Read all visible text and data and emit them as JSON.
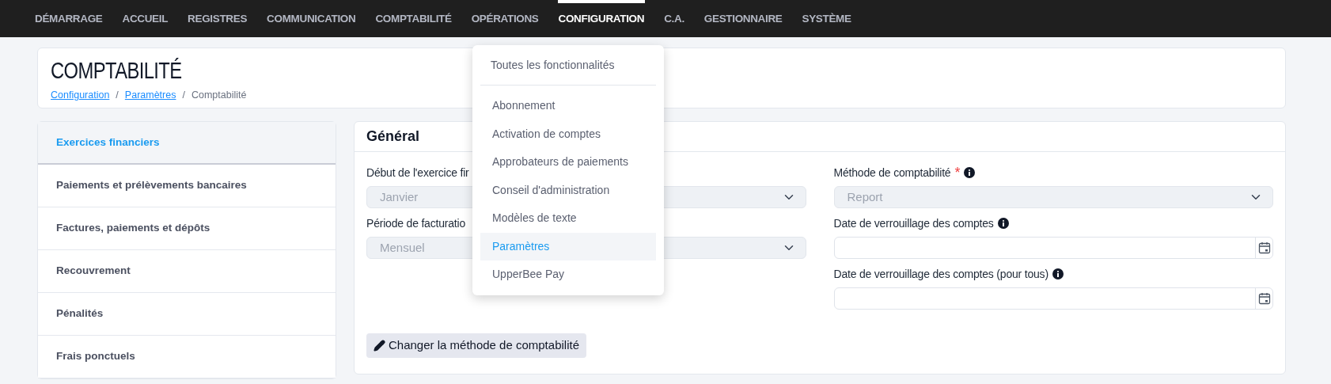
{
  "nav": [
    {
      "label": "DÉMARRAGE",
      "selected": false
    },
    {
      "label": "ACCUEIL",
      "selected": false
    },
    {
      "label": "REGISTRES",
      "selected": false
    },
    {
      "label": "COMMUNICATION",
      "selected": false
    },
    {
      "label": "COMPTABILITÉ",
      "selected": false
    },
    {
      "label": "OPÉRATIONS",
      "selected": false
    },
    {
      "label": "CONFIGURATION",
      "selected": true
    },
    {
      "label": "C.A.",
      "selected": false
    },
    {
      "label": "GESTIONNAIRE",
      "selected": false
    },
    {
      "label": "SYSTÈME",
      "selected": false
    }
  ],
  "page": {
    "title": "COMPTABILITÉ",
    "breadcrumb": [
      {
        "kind": "link",
        "label": "Configuration"
      },
      {
        "kind": "separator",
        "label": "/"
      },
      {
        "kind": "link",
        "label": "Paramètres"
      },
      {
        "kind": "separator",
        "label": "/"
      },
      {
        "kind": "current",
        "label": "Comptabilité"
      }
    ]
  },
  "sidebar": [
    {
      "label": "Exercices financiers",
      "selected": true
    },
    {
      "label": "Paiements et prélèvements bancaires",
      "selected": false
    },
    {
      "label": "Factures, paiements et dépôts",
      "selected": false
    },
    {
      "label": "Recouvrement",
      "selected": false
    },
    {
      "label": "Pénalités",
      "selected": false
    },
    {
      "label": "Frais ponctuels",
      "selected": false
    }
  ],
  "section": {
    "title": "Général",
    "left_fields": [
      {
        "kind": "select",
        "label": "Début de l'exercice fir",
        "value": "Janvier"
      },
      {
        "kind": "select",
        "label": "Période de facturatio",
        "value": "Mensuel"
      }
    ],
    "right_fields": [
      {
        "kind": "select",
        "label": "Méthode de comptabilité",
        "value": "Report",
        "required": true,
        "info": true
      },
      {
        "kind": "date",
        "label": "Date de verrouillage des comptes",
        "required": false,
        "info": true
      },
      {
        "kind": "date",
        "label": "Date de verrouillage des comptes (pour tous)",
        "required": false,
        "info": true
      }
    ],
    "required_mark": "*",
    "button": "Changer la méthode de comptabilité"
  },
  "menu": {
    "top_item": {
      "label": "Toutes les fonctionnalités",
      "selected": false
    },
    "items": [
      {
        "label": "Abonnement",
        "selected": false
      },
      {
        "label": "Activation de comptes",
        "selected": false
      },
      {
        "label": "Approbateurs de paiements",
        "selected": false
      },
      {
        "label": "Conseil d'administration",
        "selected": false
      },
      {
        "label": "Modèles de texte",
        "selected": false
      },
      {
        "label": "Paramètres",
        "selected": true
      },
      {
        "label": "UpperBee Pay",
        "selected": false
      }
    ]
  }
}
